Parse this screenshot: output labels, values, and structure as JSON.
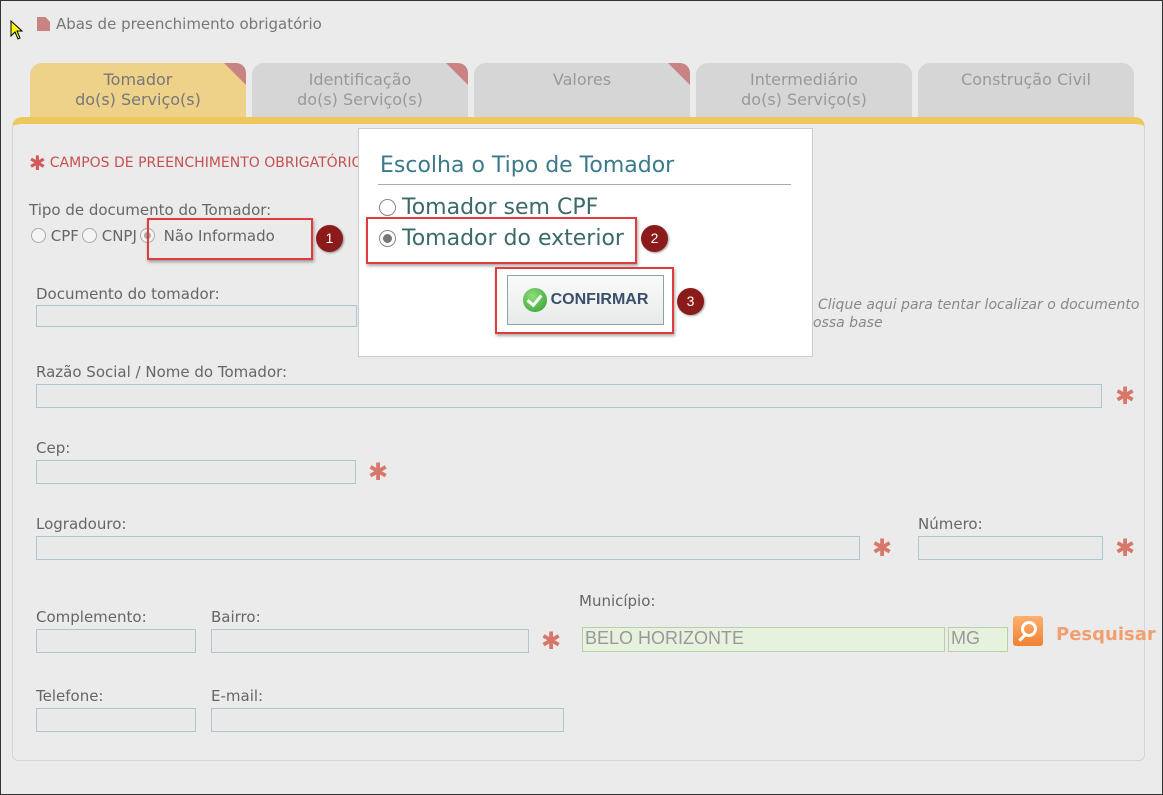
{
  "legend": {
    "text": "Abas de preenchimento obrigatório"
  },
  "tabs": [
    {
      "line1": "Tomador",
      "line2": "do(s) Serviço(s)"
    },
    {
      "line1": "Identificação",
      "line2": "do(s) Serviço(s)"
    },
    {
      "line1": "Valores",
      "line2": ""
    },
    {
      "line1": "Intermediário",
      "line2": "do(s) Serviço(s)"
    },
    {
      "line1": "Construção Civil",
      "line2": ""
    }
  ],
  "form": {
    "required_heading": "CAMPOS DE PREENCHIMENTO OBRIGATÓRIO",
    "doc_type_label": "Tipo de documento do Tomador:",
    "doc_type_options": [
      "CPF",
      "CNPJ",
      "Não Informado"
    ],
    "doc_type_selected": "Não Informado",
    "document_label": "Documento do tomador:",
    "document_hint_line1": "Clique aqui para tentar localizar o documento",
    "document_hint_line2": "ossa base",
    "razao_label": "Razão Social / Nome do Tomador:",
    "cep_label": "Cep:",
    "logradouro_label": "Logradouro:",
    "numero_label": "Número:",
    "complemento_label": "Complemento:",
    "bairro_label": "Bairro:",
    "municipio_label": "Município:",
    "municipio_value": "BELO HORIZONTE",
    "uf_value": "MG",
    "search_label": "Pesquisar",
    "telefone_label": "Telefone:",
    "email_label": "E-mail:"
  },
  "modal": {
    "title": "Escolha o Tipo de Tomador",
    "options": [
      "Tomador sem CPF",
      "Tomador do exterior"
    ],
    "selected": "Tomador do exterior",
    "confirm_label": "CONFIRMAR"
  },
  "badges": [
    "1",
    "2",
    "3"
  ],
  "colors": {
    "highlight": "#e03c3c",
    "badge": "#8b1a1a",
    "active_tab": "#efd28a",
    "tab_bar": "#efc85d"
  }
}
